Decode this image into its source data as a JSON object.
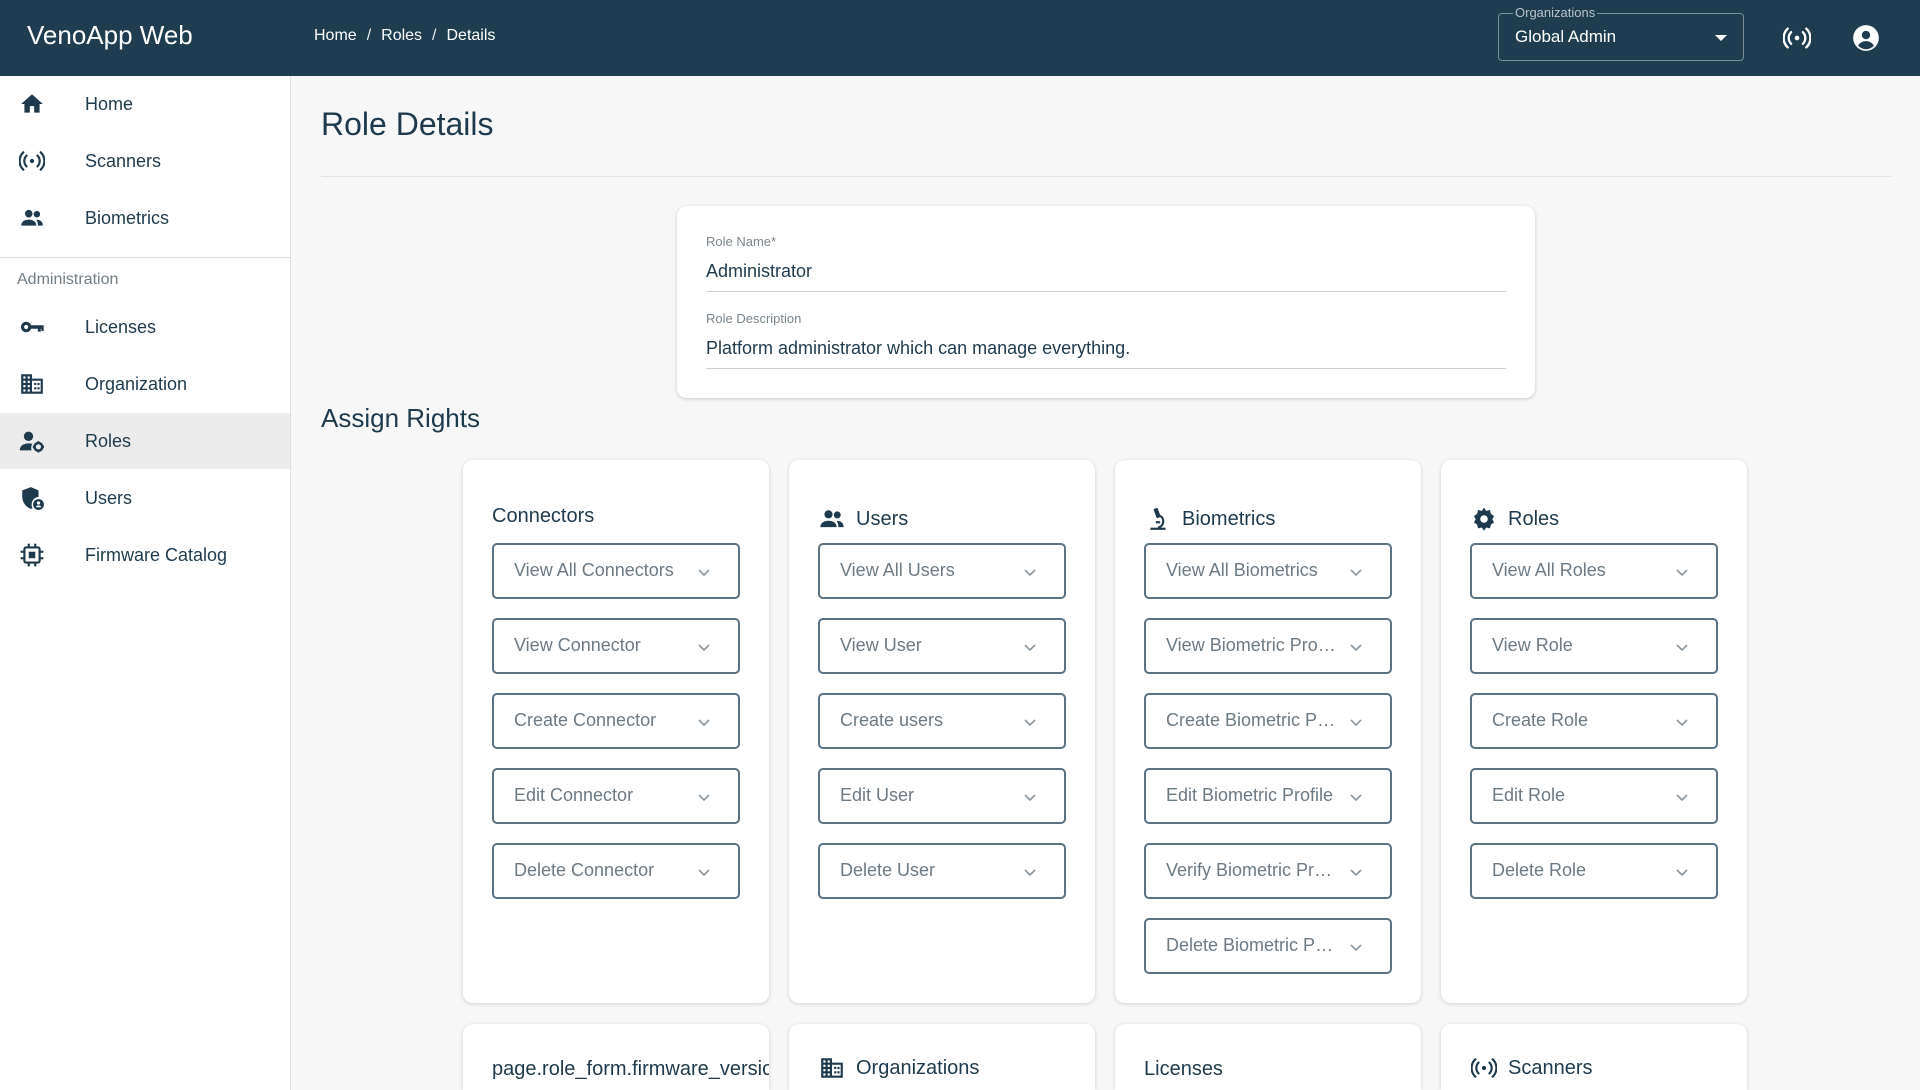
{
  "header": {
    "app_title": "VenoApp Web",
    "breadcrumb": [
      "Home",
      "Roles",
      "Details"
    ],
    "breadcrumb_sep": "/",
    "org_label": "Organizations",
    "org_value": "Global Admin"
  },
  "sidebar": {
    "items": [
      {
        "label": "Home",
        "icon": "home-icon"
      },
      {
        "label": "Scanners",
        "icon": "scanner-icon"
      },
      {
        "label": "Biometrics",
        "icon": "people-icon"
      }
    ],
    "section_label": "Administration",
    "admin_items": [
      {
        "label": "Licenses",
        "icon": "key-icon"
      },
      {
        "label": "Organization",
        "icon": "building-icon"
      },
      {
        "label": "Roles",
        "icon": "role-settings-icon",
        "active": true
      },
      {
        "label": "Users",
        "icon": "shield-user-icon"
      },
      {
        "label": "Firmware Catalog",
        "icon": "chip-icon"
      }
    ]
  },
  "main": {
    "page_title": "Role Details",
    "role_name_label": "Role Name",
    "role_name_required": "*",
    "role_name_value": "Administrator",
    "role_description_label": "Role Description",
    "role_description_value": "Platform administrator which can manage everything.",
    "assign_rights_title": "Assign Rights",
    "cards": [
      {
        "title": "Connectors",
        "icon": "",
        "permissions": [
          "View All Connectors",
          "View Connector",
          "Create Connector",
          "Edit Connector",
          "Delete Connector"
        ]
      },
      {
        "title": "Users",
        "icon": "people-icon",
        "permissions": [
          "View All Users",
          "View User",
          "Create users",
          "Edit User",
          "Delete User"
        ]
      },
      {
        "title": "Biometrics",
        "icon": "microscope-icon",
        "permissions": [
          "View All Biometrics",
          "View Biometric Profile",
          "Create Biometric Profile",
          "Edit Biometric Profile",
          "Verify Biometric Profile",
          "Delete Biometric Profile"
        ]
      },
      {
        "title": "Roles",
        "icon": "gear-icon",
        "permissions": [
          "View All Roles",
          "View Role",
          "Create Role",
          "Edit Role",
          "Delete Role"
        ]
      },
      {
        "title": "page.role_form.firmware_versions",
        "icon": "",
        "permissions": []
      },
      {
        "title": "Organizations",
        "icon": "building-icon",
        "permissions": []
      },
      {
        "title": "Licenses",
        "icon": "",
        "permissions": []
      },
      {
        "title": "Scanners",
        "icon": "scanner-icon",
        "permissions": []
      }
    ]
  },
  "colors": {
    "topbar": "#1e3d50",
    "text": "#1f3a4c",
    "border": "#5b7282"
  }
}
